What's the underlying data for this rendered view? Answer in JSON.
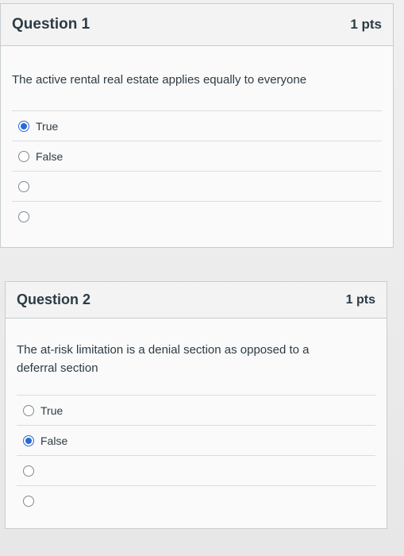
{
  "questions": [
    {
      "title": "Question 1",
      "points": "1 pts",
      "text": "The active rental real estate applies equally to everyone",
      "answers": [
        {
          "label": "True",
          "selected": true
        },
        {
          "label": "False",
          "selected": false
        },
        {
          "label": "",
          "selected": false
        },
        {
          "label": "",
          "selected": false
        }
      ]
    },
    {
      "title": "Question 2",
      "points": "1 pts",
      "text": "The at-risk limitation is a denial section as opposed to a deferral section",
      "answers": [
        {
          "label": "True",
          "selected": false
        },
        {
          "label": "False",
          "selected": true
        },
        {
          "label": "",
          "selected": false
        },
        {
          "label": "",
          "selected": false
        }
      ]
    }
  ],
  "colors": {
    "accent": "#2a6ad8",
    "text": "#2d3b45",
    "border": "#c7cdd1"
  }
}
